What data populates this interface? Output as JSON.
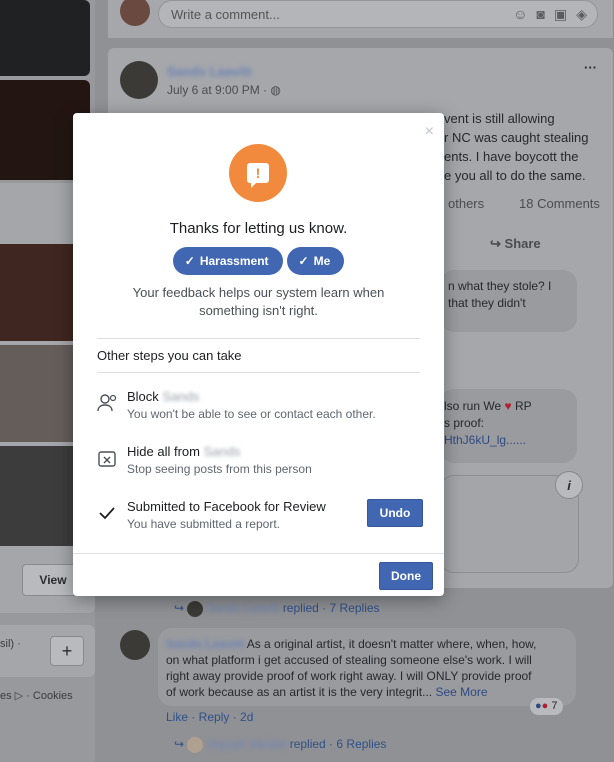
{
  "background": {
    "left_column": {
      "view_label": "View",
      "plus_label": "+",
      "footer_left": "sil) ·",
      "footer_links": "es ▷ · Cookies"
    },
    "comment_box": {
      "placeholder": "Write a comment..."
    },
    "post": {
      "author": "Sands Laavitt",
      "time": "July 6 at 9:00 PM ·",
      "more": "···",
      "text_lines": [
        "vent is still allowing",
        "r NC was caught stealing",
        "ents. I have boycott the",
        "e you all to do the same."
      ],
      "others": "others",
      "comments_count": "18 Comments",
      "share": "Share",
      "reply1_lines": [
        "n what they stole? I",
        "that they didn't"
      ],
      "reply2_lines": [
        "lso run We",
        "RP",
        "s proof:",
        "HthJ6kU_lg......"
      ],
      "replied_line": "replied · 7 Replies",
      "comment_author": "Sands Laavitt",
      "comment_lines": [
        "As a original artist, it doesn't matter where, when, how,",
        "on what platform i get accused of stealing someone else's work. I will",
        "right away provide proof of work right away. I will ONLY provide proof",
        "of work because as an artist it is the very integrit..."
      ],
      "see_more": "See More",
      "reaction_count": "7",
      "actions": "Like · Reply · 2d",
      "replied_line2_name": "Vayyah Variate",
      "replied_line2": "replied · 6 Replies",
      "reply_name_blur": "Sands Laavitt"
    }
  },
  "modal": {
    "close": "×",
    "title": "Thanks for letting us know.",
    "tags": [
      "Harassment",
      "Me"
    ],
    "description": "Your feedback helps our system learn when something isn't right.",
    "steps_title": "Other steps you can take",
    "steps": [
      {
        "heading": "Block",
        "name": "Sands",
        "sub": "You won't be able to see or contact each other."
      },
      {
        "heading": "Hide all from",
        "name": "Sands",
        "sub": "Stop seeing posts from this person"
      },
      {
        "heading": "Submitted to Facebook for Review",
        "sub": "You have submitted a report."
      }
    ],
    "undo": "Undo",
    "done": "Done"
  }
}
